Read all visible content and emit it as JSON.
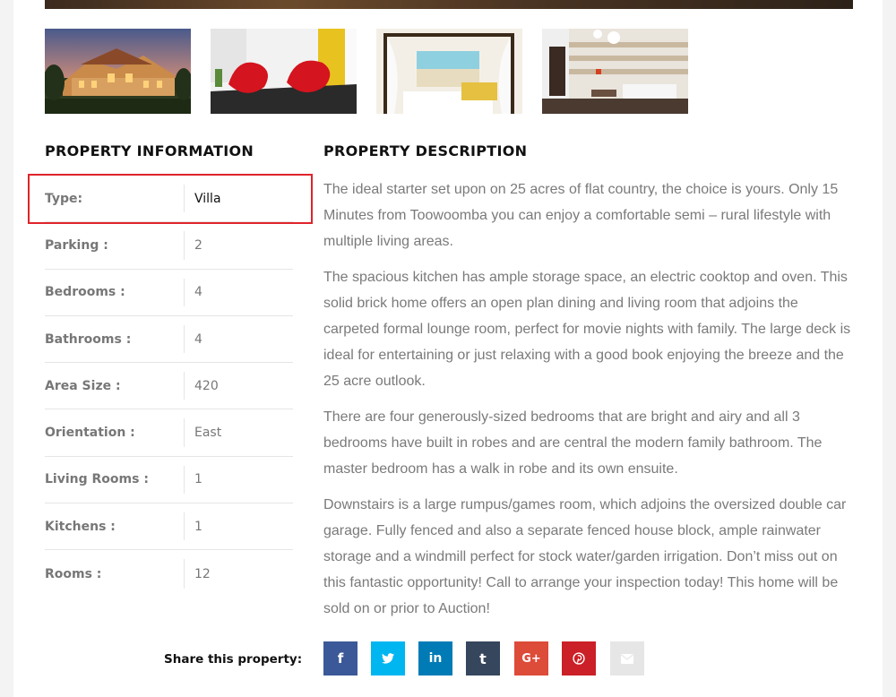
{
  "colors": {
    "highlight": "#e0232a",
    "facebook": "#3b5998",
    "twitter": "#00b6f1",
    "linkedin": "#007bb6",
    "tumblr": "#35465d",
    "googleplus": "#dd4b39",
    "pinterest": "#cb2027",
    "email": "#e6e6e6"
  },
  "gallery": {
    "thumbnails": [
      {
        "icon": "villa-exterior-photo"
      },
      {
        "icon": "red-chairs-interior-photo"
      },
      {
        "icon": "canopy-bedroom-photo"
      },
      {
        "icon": "living-room-photo"
      }
    ]
  },
  "info": {
    "title": "PROPERTY INFORMATION",
    "rows": [
      {
        "label": "Type:",
        "value": "Villa"
      },
      {
        "label": "Parking :",
        "value": "2"
      },
      {
        "label": "Bedrooms :",
        "value": "4"
      },
      {
        "label": "Bathrooms :",
        "value": "4"
      },
      {
        "label": "Area Size :",
        "value": "420"
      },
      {
        "label": "Orientation :",
        "value": "East"
      },
      {
        "label": "Living Rooms :",
        "value": "1"
      },
      {
        "label": "Kitchens :",
        "value": "1"
      },
      {
        "label": "Rooms :",
        "value": "12"
      }
    ]
  },
  "description": {
    "title": "PROPERTY DESCRIPTION",
    "paragraphs": [
      "The ideal starter set upon on 25 acres of flat country, the choice is yours. Only 15 Minutes from Toowoomba you can enjoy a comfortable semi – rural lifestyle with multiple living areas.",
      "The spacious kitchen has ample storage space, an electric cooktop and oven. This solid brick home offers an open plan dining and living room that adjoins the carpeted formal lounge room, perfect for movie nights with family. The large deck is ideal for entertaining or just relaxing with a good book enjoying the breeze and the 25 acre outlook.",
      "There are four generously-sized bedrooms that are bright and airy and all 3 bedrooms have built in robes and are central the modern family bathroom. The master bedroom has a walk in robe and its own ensuite.",
      "Downstairs is a large rumpus/games room, which adjoins the oversized double car garage. Fully fenced and also a separate fenced house block, ample rainwater storage and a windmill perfect for stock water/garden irrigation. Don’t miss out on this fantastic opportunity! Call to arrange your inspection today! This home will be sold on or prior to Auction!"
    ]
  },
  "share": {
    "label": "Share this property:",
    "buttons": [
      {
        "icon": "facebook-icon",
        "glyph": "f"
      },
      {
        "icon": "twitter-icon",
        "glyph": ""
      },
      {
        "icon": "linkedin-icon",
        "glyph": "in"
      },
      {
        "icon": "tumblr-icon",
        "glyph": "t"
      },
      {
        "icon": "googleplus-icon",
        "glyph": "G+"
      },
      {
        "icon": "pinterest-icon",
        "glyph": ""
      },
      {
        "icon": "email-icon",
        "glyph": ""
      }
    ]
  }
}
